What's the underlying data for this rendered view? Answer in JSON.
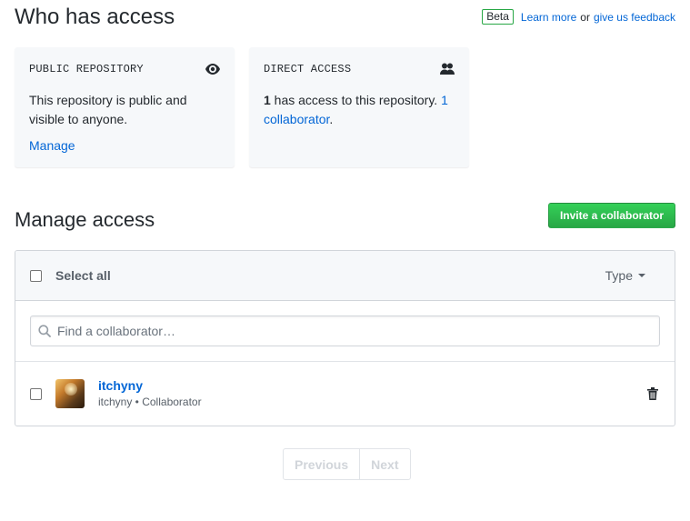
{
  "header": {
    "title": "Who has access",
    "beta": "Beta",
    "learn_more": "Learn more",
    "or": "or",
    "feedback": "give us feedback"
  },
  "cards": {
    "public": {
      "title": "PUBLIC REPOSITORY",
      "icon": "eye-icon",
      "body": "This repository is public and visible to anyone.",
      "manage": "Manage"
    },
    "direct": {
      "title": "DIRECT ACCESS",
      "icon": "people-icon",
      "count": "1",
      "body_mid": " has access to this repository. ",
      "link": "1 collaborator",
      "period": "."
    }
  },
  "manage": {
    "title": "Manage access",
    "invite_button": "Invite a collaborator",
    "select_all": "Select all",
    "type_label": "Type",
    "search_placeholder": "Find a collaborator…",
    "collaborators": [
      {
        "username": "itchyny",
        "role_line": "itchyny • Collaborator"
      }
    ]
  },
  "pagination": {
    "previous": "Previous",
    "next": "Next"
  },
  "colors": {
    "link": "#0366d6",
    "primary_button": "#28a745",
    "card_bg": "#f6f8fa"
  }
}
